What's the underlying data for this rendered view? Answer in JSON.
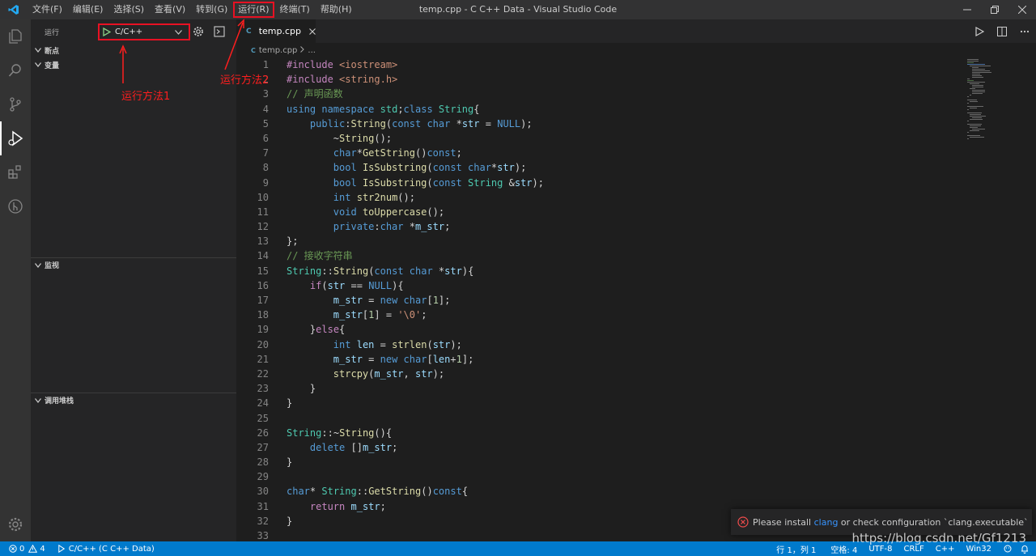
{
  "window": {
    "title": "temp.cpp - C C++ Data - Visual Studio Code"
  },
  "menu": [
    "文件(F)",
    "编辑(E)",
    "选择(S)",
    "查看(V)",
    "转到(G)",
    "运行(R)",
    "终端(T)",
    "帮助(H)"
  ],
  "menu_highlighted": "运行(R)",
  "activity_icons": [
    "files-icon",
    "search-icon",
    "source-control-icon",
    "run-debug-icon",
    "extensions-icon",
    "git-graph-icon",
    "settings-gear-icon"
  ],
  "sidebar": {
    "title": "运行",
    "config": "C/C++",
    "sections": [
      "断点",
      "变量",
      "监视",
      "调用堆栈"
    ]
  },
  "annotations": {
    "method1": "运行方法1",
    "method2": "运行方法2"
  },
  "editor": {
    "tab": "temp.cpp",
    "breadcrumb_file": "temp.cpp",
    "breadcrumb_rest": "...",
    "lines": [
      "#include <iostream>",
      "#include <string.h>",
      "// 声明函数",
      "using namespace std;class String{",
      "    public:String(const char *str = NULL);",
      "        ~String();",
      "        char*GetString()const;",
      "        bool IsSubstring(const char*str);",
      "        bool IsSubstring(const String &str);",
      "        int str2num();",
      "        void toUppercase();",
      "        private:char *m_str;",
      "};",
      "// 接收字符串",
      "String::String(const char *str){",
      "    if(str == NULL){",
      "        m_str = new char[1];",
      "        m_str[1] = '\\0';",
      "    }else{",
      "        int len = strlen(str);",
      "        m_str = new char[len+1];",
      "        strcpy(m_str, str);",
      "    }",
      "}",
      "",
      "String::~String(){",
      "    delete []m_str;",
      "}",
      "",
      "char* String::GetString()const{",
      "    return m_str;",
      "}",
      ""
    ]
  },
  "notification": {
    "prefix": "Please install ",
    "link": "clang",
    "suffix": " or check configuration `clang.executable`"
  },
  "statusbar": {
    "errors": "0",
    "warnings": "4",
    "debug_config": "C/C++ (C C++ Data)",
    "position": "行 1，列 1",
    "spaces": "空格: 4",
    "encoding": "UTF-8",
    "eol": "CRLF",
    "language": "C++",
    "platform": "Win32"
  },
  "watermark": "https://blog.csdn.net/Gf1213",
  "colors": {
    "accent": "#007acc",
    "highlight": "#e81123",
    "annotation": "#ff1e1e"
  }
}
